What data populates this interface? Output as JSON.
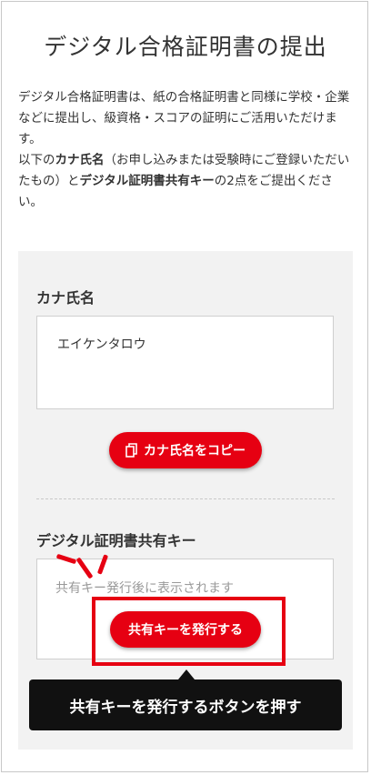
{
  "page": {
    "title": "デジタル合格証明書の提出"
  },
  "intro": {
    "line1": "デジタル合格証明書は、紙の合格証明書と同様に学校・企業などに提出し、級資格・スコアの証明にご活用いただけます。",
    "line2_pre": "以下の",
    "line2_bold1": "カナ氏名",
    "line2_mid": "（お申し込みまたは受験時にご登録いただいたもの）と",
    "line2_bold2": "デジタル証明書共有キー",
    "line2_post": "の2点をご提出ください。"
  },
  "kana": {
    "label": "カナ氏名",
    "value": "エイケンタロウ",
    "copy_button": "カナ氏名をコピー",
    "copy_icon": "copy-icon"
  },
  "share_key": {
    "label": "デジタル証明書共有キー",
    "placeholder": "共有キー発行後に表示されます",
    "issue_button": "共有キーを発行する"
  },
  "annotation": {
    "tooltip": "共有キーを発行するボタンを押す",
    "accent": "#e60012"
  }
}
